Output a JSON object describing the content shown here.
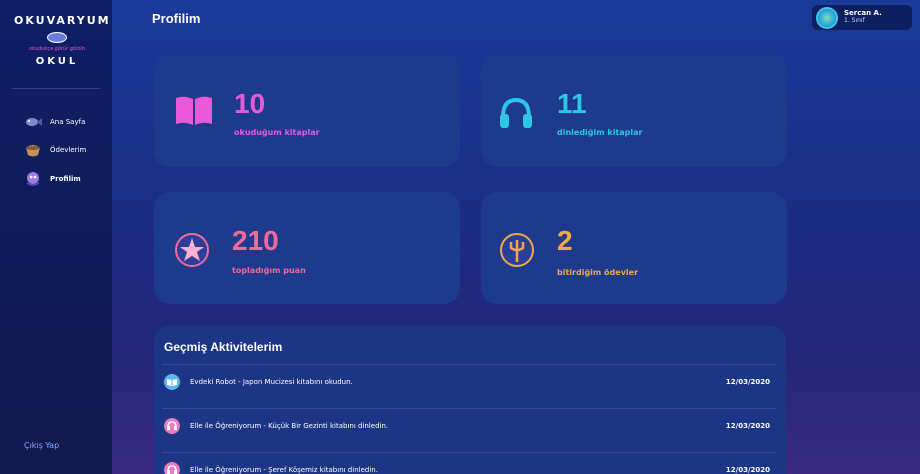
{
  "app": {
    "logo": {
      "top": "OKUVARYUM",
      "sub": "okudukça görür gözün",
      "bottom": "OKUL"
    }
  },
  "sidebar": {
    "items": [
      {
        "label": "Ana Sayfa",
        "icon": "fish-icon",
        "active": false
      },
      {
        "label": "Ödevlerim",
        "icon": "bowl-icon",
        "active": false
      },
      {
        "label": "Profilim",
        "icon": "octopus-icon",
        "active": true
      }
    ],
    "logout_label": "Çıkış Yap"
  },
  "header": {
    "title": "Profilim",
    "user": {
      "name": "Sercan A.",
      "class": "1. Sınıf"
    }
  },
  "stats": [
    {
      "value": "10",
      "label": "okuduğum kitaplar",
      "icon": "book-icon",
      "color": "#e85ad8",
      "number_color": "#e85ad8"
    },
    {
      "value": "11",
      "label": "dinlediğim kitaplar",
      "icon": "headphones-icon",
      "color": "#2ec6e8",
      "number_color": "#2ec6e8"
    },
    {
      "value": "210",
      "label": "topladığım puan",
      "icon": "starfish-icon",
      "color": "#f06a9c",
      "number_color": "#f06a9c"
    },
    {
      "value": "2",
      "label": "bitirdiğim ödevler",
      "icon": "trident-icon",
      "color": "#f0a848",
      "number_color": "#f0a848"
    }
  ],
  "activities": {
    "title": "Geçmiş Aktivitelerim",
    "rows": [
      {
        "text": "Evdeki Robot - Japon Mucizesi kitabını okudun.",
        "date": "12/03/2020",
        "icon": "book-icon",
        "color": "#5fb8f0"
      },
      {
        "text": "Elle ile Öğreniyorum - Küçük Bir Gezinti kitabını dinledin.",
        "date": "12/03/2020",
        "icon": "headphones-icon",
        "color": "#f07ac0"
      },
      {
        "text": "Elle ile Öğreniyorum - Şeref Köşemiz kitabını dinledin.",
        "date": "12/03/2020",
        "icon": "headphones-icon",
        "color": "#f07ac0"
      }
    ]
  }
}
